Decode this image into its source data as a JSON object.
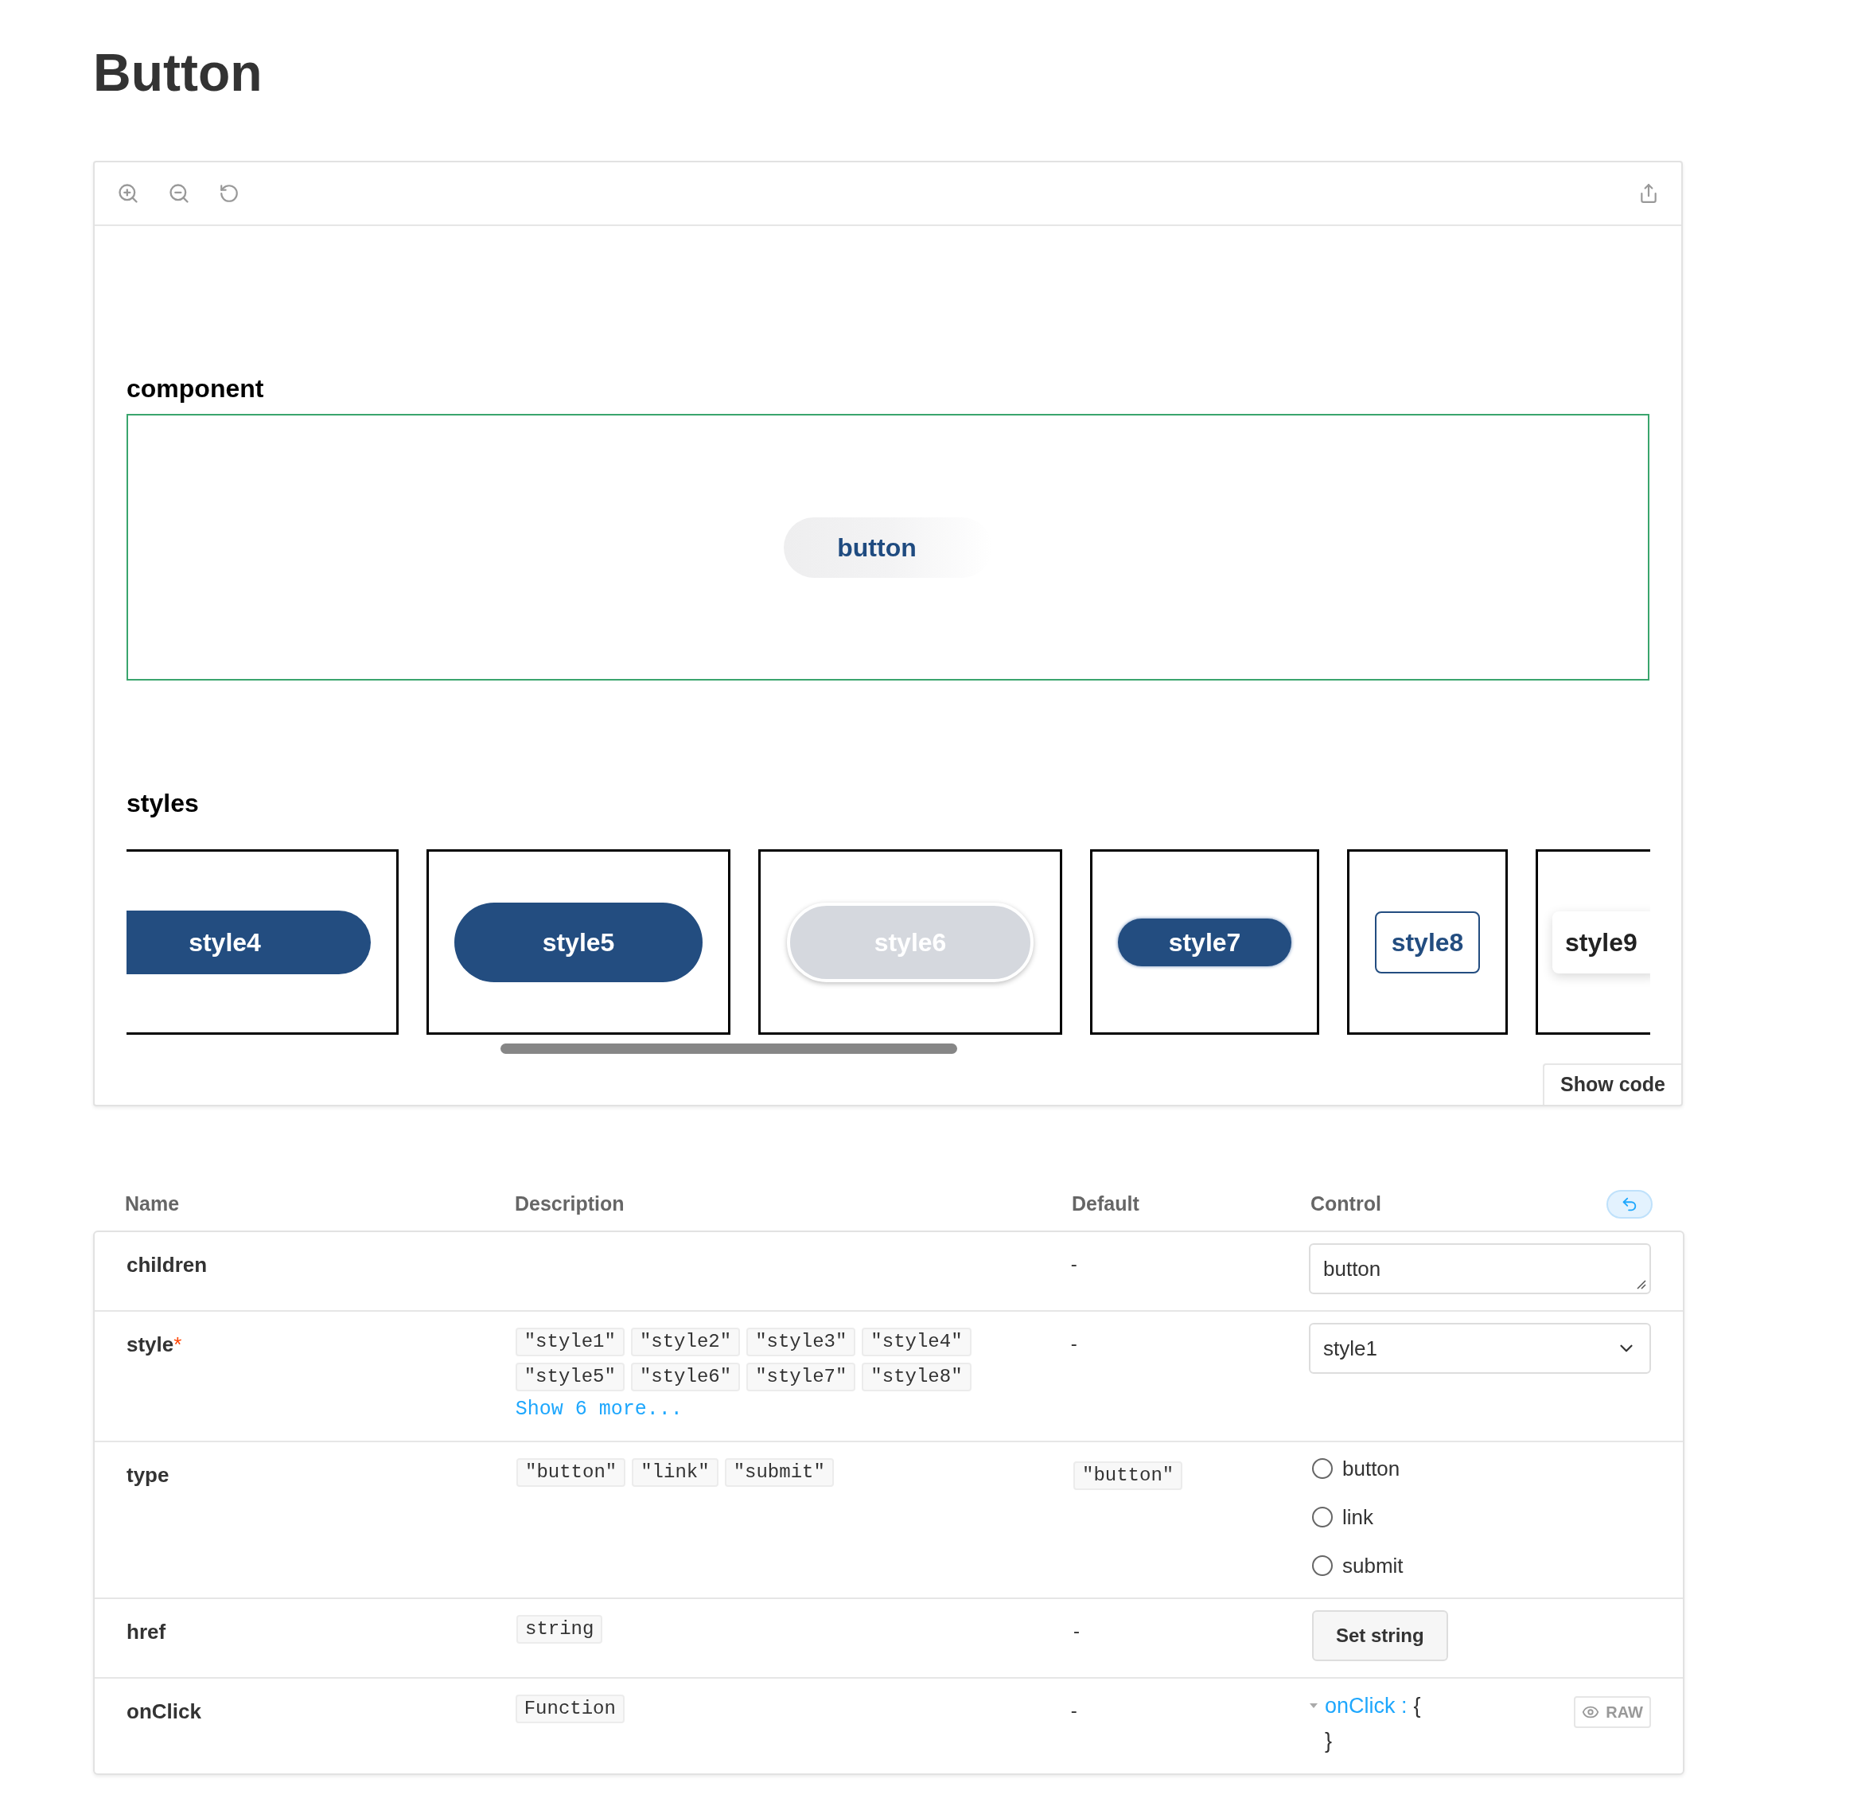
{
  "title": "Button",
  "canvas": {
    "sections": [
      {
        "heading": "component"
      },
      {
        "heading": "styles"
      }
    ],
    "preview_button": "button",
    "styles": [
      {
        "label": "style4",
        "kind": "flat"
      },
      {
        "label": "style5",
        "kind": "pill"
      },
      {
        "label": "style6",
        "kind": "disabled"
      },
      {
        "label": "style7",
        "kind": "small"
      },
      {
        "label": "style8",
        "kind": "outline"
      },
      {
        "label": "style9",
        "kind": "shadow"
      }
    ],
    "show_code": "Show code"
  },
  "table": {
    "columns": [
      "Name",
      "Description",
      "Default",
      "Control"
    ],
    "rows": [
      {
        "name": "children",
        "description": [],
        "default": "-",
        "control": {
          "kind": "text",
          "value": "button"
        }
      },
      {
        "name": "style",
        "required_mark": "*",
        "description": [
          "\"style1\"",
          "\"style2\"",
          "\"style3\"",
          "\"style4\"",
          "\"style5\"",
          "\"style6\"",
          "\"style7\"",
          "\"style8\""
        ],
        "more": "Show 6 more...",
        "default": "-",
        "control": {
          "kind": "select",
          "value": "style1"
        }
      },
      {
        "name": "type",
        "description": [
          "\"button\"",
          "\"link\"",
          "\"submit\""
        ],
        "default_code": "\"button\"",
        "control": {
          "kind": "radio",
          "options": [
            {
              "label": "button",
              "selected": false
            },
            {
              "label": "link",
              "selected": false
            },
            {
              "label": "submit",
              "selected": false
            }
          ]
        }
      },
      {
        "name": "href",
        "description": [
          "string"
        ],
        "default": "-",
        "control": {
          "kind": "button",
          "label": "Set string"
        }
      },
      {
        "name": "onClick",
        "description": [
          "Function"
        ],
        "default": "-",
        "control": {
          "kind": "object",
          "key": "onClick :",
          "open": "{",
          "close": "}",
          "raw": "RAW"
        }
      }
    ]
  }
}
